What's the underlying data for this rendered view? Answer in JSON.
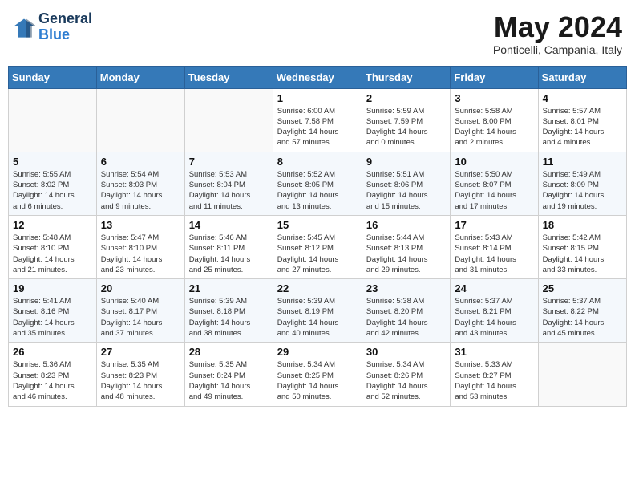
{
  "logo": {
    "line1": "General",
    "line2": "Blue"
  },
  "title": "May 2024",
  "subtitle": "Ponticelli, Campania, Italy",
  "weekdays": [
    "Sunday",
    "Monday",
    "Tuesday",
    "Wednesday",
    "Thursday",
    "Friday",
    "Saturday"
  ],
  "weeks": [
    [
      {
        "day": "",
        "info": ""
      },
      {
        "day": "",
        "info": ""
      },
      {
        "day": "",
        "info": ""
      },
      {
        "day": "1",
        "info": "Sunrise: 6:00 AM\nSunset: 7:58 PM\nDaylight: 14 hours\nand 57 minutes."
      },
      {
        "day": "2",
        "info": "Sunrise: 5:59 AM\nSunset: 7:59 PM\nDaylight: 14 hours\nand 0 minutes."
      },
      {
        "day": "3",
        "info": "Sunrise: 5:58 AM\nSunset: 8:00 PM\nDaylight: 14 hours\nand 2 minutes."
      },
      {
        "day": "4",
        "info": "Sunrise: 5:57 AM\nSunset: 8:01 PM\nDaylight: 14 hours\nand 4 minutes."
      }
    ],
    [
      {
        "day": "5",
        "info": "Sunrise: 5:55 AM\nSunset: 8:02 PM\nDaylight: 14 hours\nand 6 minutes."
      },
      {
        "day": "6",
        "info": "Sunrise: 5:54 AM\nSunset: 8:03 PM\nDaylight: 14 hours\nand 9 minutes."
      },
      {
        "day": "7",
        "info": "Sunrise: 5:53 AM\nSunset: 8:04 PM\nDaylight: 14 hours\nand 11 minutes."
      },
      {
        "day": "8",
        "info": "Sunrise: 5:52 AM\nSunset: 8:05 PM\nDaylight: 14 hours\nand 13 minutes."
      },
      {
        "day": "9",
        "info": "Sunrise: 5:51 AM\nSunset: 8:06 PM\nDaylight: 14 hours\nand 15 minutes."
      },
      {
        "day": "10",
        "info": "Sunrise: 5:50 AM\nSunset: 8:07 PM\nDaylight: 14 hours\nand 17 minutes."
      },
      {
        "day": "11",
        "info": "Sunrise: 5:49 AM\nSunset: 8:09 PM\nDaylight: 14 hours\nand 19 minutes."
      }
    ],
    [
      {
        "day": "12",
        "info": "Sunrise: 5:48 AM\nSunset: 8:10 PM\nDaylight: 14 hours\nand 21 minutes."
      },
      {
        "day": "13",
        "info": "Sunrise: 5:47 AM\nSunset: 8:10 PM\nDaylight: 14 hours\nand 23 minutes."
      },
      {
        "day": "14",
        "info": "Sunrise: 5:46 AM\nSunset: 8:11 PM\nDaylight: 14 hours\nand 25 minutes."
      },
      {
        "day": "15",
        "info": "Sunrise: 5:45 AM\nSunset: 8:12 PM\nDaylight: 14 hours\nand 27 minutes."
      },
      {
        "day": "16",
        "info": "Sunrise: 5:44 AM\nSunset: 8:13 PM\nDaylight: 14 hours\nand 29 minutes."
      },
      {
        "day": "17",
        "info": "Sunrise: 5:43 AM\nSunset: 8:14 PM\nDaylight: 14 hours\nand 31 minutes."
      },
      {
        "day": "18",
        "info": "Sunrise: 5:42 AM\nSunset: 8:15 PM\nDaylight: 14 hours\nand 33 minutes."
      }
    ],
    [
      {
        "day": "19",
        "info": "Sunrise: 5:41 AM\nSunset: 8:16 PM\nDaylight: 14 hours\nand 35 minutes."
      },
      {
        "day": "20",
        "info": "Sunrise: 5:40 AM\nSunset: 8:17 PM\nDaylight: 14 hours\nand 37 minutes."
      },
      {
        "day": "21",
        "info": "Sunrise: 5:39 AM\nSunset: 8:18 PM\nDaylight: 14 hours\nand 38 minutes."
      },
      {
        "day": "22",
        "info": "Sunrise: 5:39 AM\nSunset: 8:19 PM\nDaylight: 14 hours\nand 40 minutes."
      },
      {
        "day": "23",
        "info": "Sunrise: 5:38 AM\nSunset: 8:20 PM\nDaylight: 14 hours\nand 42 minutes."
      },
      {
        "day": "24",
        "info": "Sunrise: 5:37 AM\nSunset: 8:21 PM\nDaylight: 14 hours\nand 43 minutes."
      },
      {
        "day": "25",
        "info": "Sunrise: 5:37 AM\nSunset: 8:22 PM\nDaylight: 14 hours\nand 45 minutes."
      }
    ],
    [
      {
        "day": "26",
        "info": "Sunrise: 5:36 AM\nSunset: 8:23 PM\nDaylight: 14 hours\nand 46 minutes."
      },
      {
        "day": "27",
        "info": "Sunrise: 5:35 AM\nSunset: 8:23 PM\nDaylight: 14 hours\nand 48 minutes."
      },
      {
        "day": "28",
        "info": "Sunrise: 5:35 AM\nSunset: 8:24 PM\nDaylight: 14 hours\nand 49 minutes."
      },
      {
        "day": "29",
        "info": "Sunrise: 5:34 AM\nSunset: 8:25 PM\nDaylight: 14 hours\nand 50 minutes."
      },
      {
        "day": "30",
        "info": "Sunrise: 5:34 AM\nSunset: 8:26 PM\nDaylight: 14 hours\nand 52 minutes."
      },
      {
        "day": "31",
        "info": "Sunrise: 5:33 AM\nSunset: 8:27 PM\nDaylight: 14 hours\nand 53 minutes."
      },
      {
        "day": "",
        "info": ""
      }
    ]
  ]
}
